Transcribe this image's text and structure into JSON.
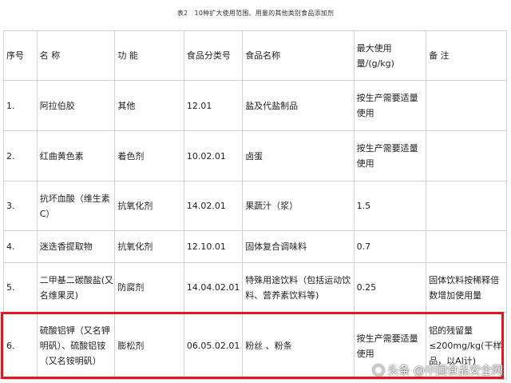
{
  "caption": "表2　10种扩大使用范围、用量的其他类别食品添加剂",
  "table": {
    "headers": [
      "序号",
      "名 称",
      "功 能",
      "食品分类号",
      "食品名称",
      "最大使用量/(g/kg)",
      "备 注"
    ],
    "rows": [
      {
        "no": "1.",
        "name": "阿拉伯胶",
        "func": "其他",
        "code": "12.01",
        "food": "盐及代盐制品",
        "max": "按生产需要适量使用",
        "note": ""
      },
      {
        "no": "2.",
        "name": "红曲黄色素",
        "func": "着色剂",
        "code": "10.02.01",
        "food": "卤蛋",
        "max": "按生产需要适量使用",
        "note": ""
      },
      {
        "no": "3.",
        "name": "抗坏血酸（维生素C）",
        "func": "抗氧化剂",
        "code": "14.02.01",
        "food": "果蔬汁（浆）",
        "max": "1.5",
        "note": ""
      },
      {
        "no": "4.",
        "name": "迷迭香提取物",
        "func": "抗氧化剂",
        "code": "12.10.01",
        "food": "固体复合调味料",
        "max": "0.7",
        "note": ""
      },
      {
        "no": "5.",
        "name": "二甲基二碳酸盐(又名维果灵)",
        "func": "防腐剂",
        "code": "14.04.02.01",
        "food": "特殊用途饮料（包括运动饮料、营养素饮料等)",
        "max": "0.25",
        "note": "固体饮料按稀释倍数增加使用量"
      },
      {
        "no": "6.",
        "name": "硫酸铝钾（又名钾明矾）、硫酸铝铵（又名铵明矾）",
        "func": "膨松剂",
        "code": "06.05.02.01",
        "food": "粉丝 、粉条",
        "max": "按生产需要适量使用",
        "note": "铝的残留量≤200mg/kg(干样品，以Al计)"
      }
    ]
  },
  "watermark": {
    "text": "头条 @中国食品安全网",
    "icon": "toutiao-logo-icon"
  },
  "colors": {
    "highlight": "#e0191f",
    "grid": "#cfcfcf"
  }
}
